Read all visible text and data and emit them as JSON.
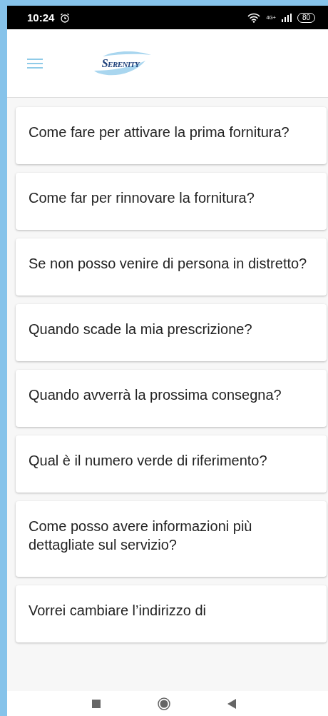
{
  "status_bar": {
    "time": "10:24",
    "network": "4G+",
    "battery": "80"
  },
  "header": {
    "logo": "Serenity"
  },
  "faq_items": [
    {
      "question": "Come fare per attivare la prima fornitura?"
    },
    {
      "question": "Come far per rinnovare la fornitura?"
    },
    {
      "question": "Se non posso venire di persona in distretto?"
    },
    {
      "question": "Quando scade la mia prescrizione?"
    },
    {
      "question": "Quando avverrà la prossima consegna?"
    },
    {
      "question": "Qual è il numero verde di riferimento?"
    },
    {
      "question": "Come posso avere informazioni più dettagliate sul servizio?"
    },
    {
      "question": "Vorrei cambiare l’indirizzo di"
    }
  ]
}
